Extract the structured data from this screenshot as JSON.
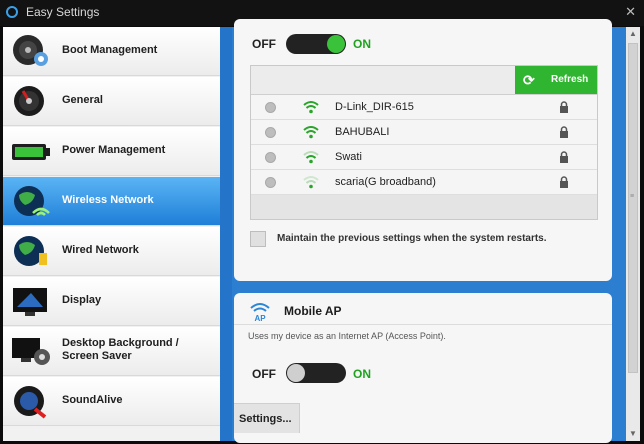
{
  "window": {
    "title": "Easy Settings",
    "close_glyph": "✕"
  },
  "sidebar": {
    "items": [
      {
        "label": "Boot Management",
        "icon": "boot-management-icon"
      },
      {
        "label": "General",
        "icon": "general-icon"
      },
      {
        "label": "Power Management",
        "icon": "battery-icon"
      },
      {
        "label": "Wireless Network",
        "icon": "wireless-globe-icon",
        "active": true
      },
      {
        "label": "Wired Network",
        "icon": "wired-globe-icon"
      },
      {
        "label": "Display",
        "icon": "display-icon"
      },
      {
        "label": "Desktop Background / Screen Saver",
        "icon": "desktop-background-icon"
      },
      {
        "label": "SoundAlive",
        "icon": "sound-icon"
      }
    ]
  },
  "wireless": {
    "toggle": {
      "off_label": "OFF",
      "on_label": "ON",
      "state": "on"
    },
    "refresh_label": "Refresh",
    "networks": [
      {
        "ssid": "D-Link_DIR-615",
        "signal": 4,
        "secured": true
      },
      {
        "ssid": "BAHUBALI",
        "signal": 4,
        "secured": true
      },
      {
        "ssid": "Swati",
        "signal": 3,
        "secured": true
      },
      {
        "ssid": "scaria(G broadband)",
        "signal": 2,
        "secured": true
      }
    ],
    "maintain_label": "Maintain the previous settings when the system restarts.",
    "maintain_checked": false
  },
  "mobile_ap": {
    "title": "Mobile AP",
    "icon_text": "AP",
    "description": "Uses my device as an Internet AP (Access Point).",
    "toggle": {
      "off_label": "OFF",
      "on_label": "ON",
      "state": "off"
    },
    "settings_label": "Settings..."
  },
  "colors": {
    "accent_green": "#2fb52f",
    "active_blue": "#1f7fd8",
    "panel_bg": "#2c7fd0"
  }
}
